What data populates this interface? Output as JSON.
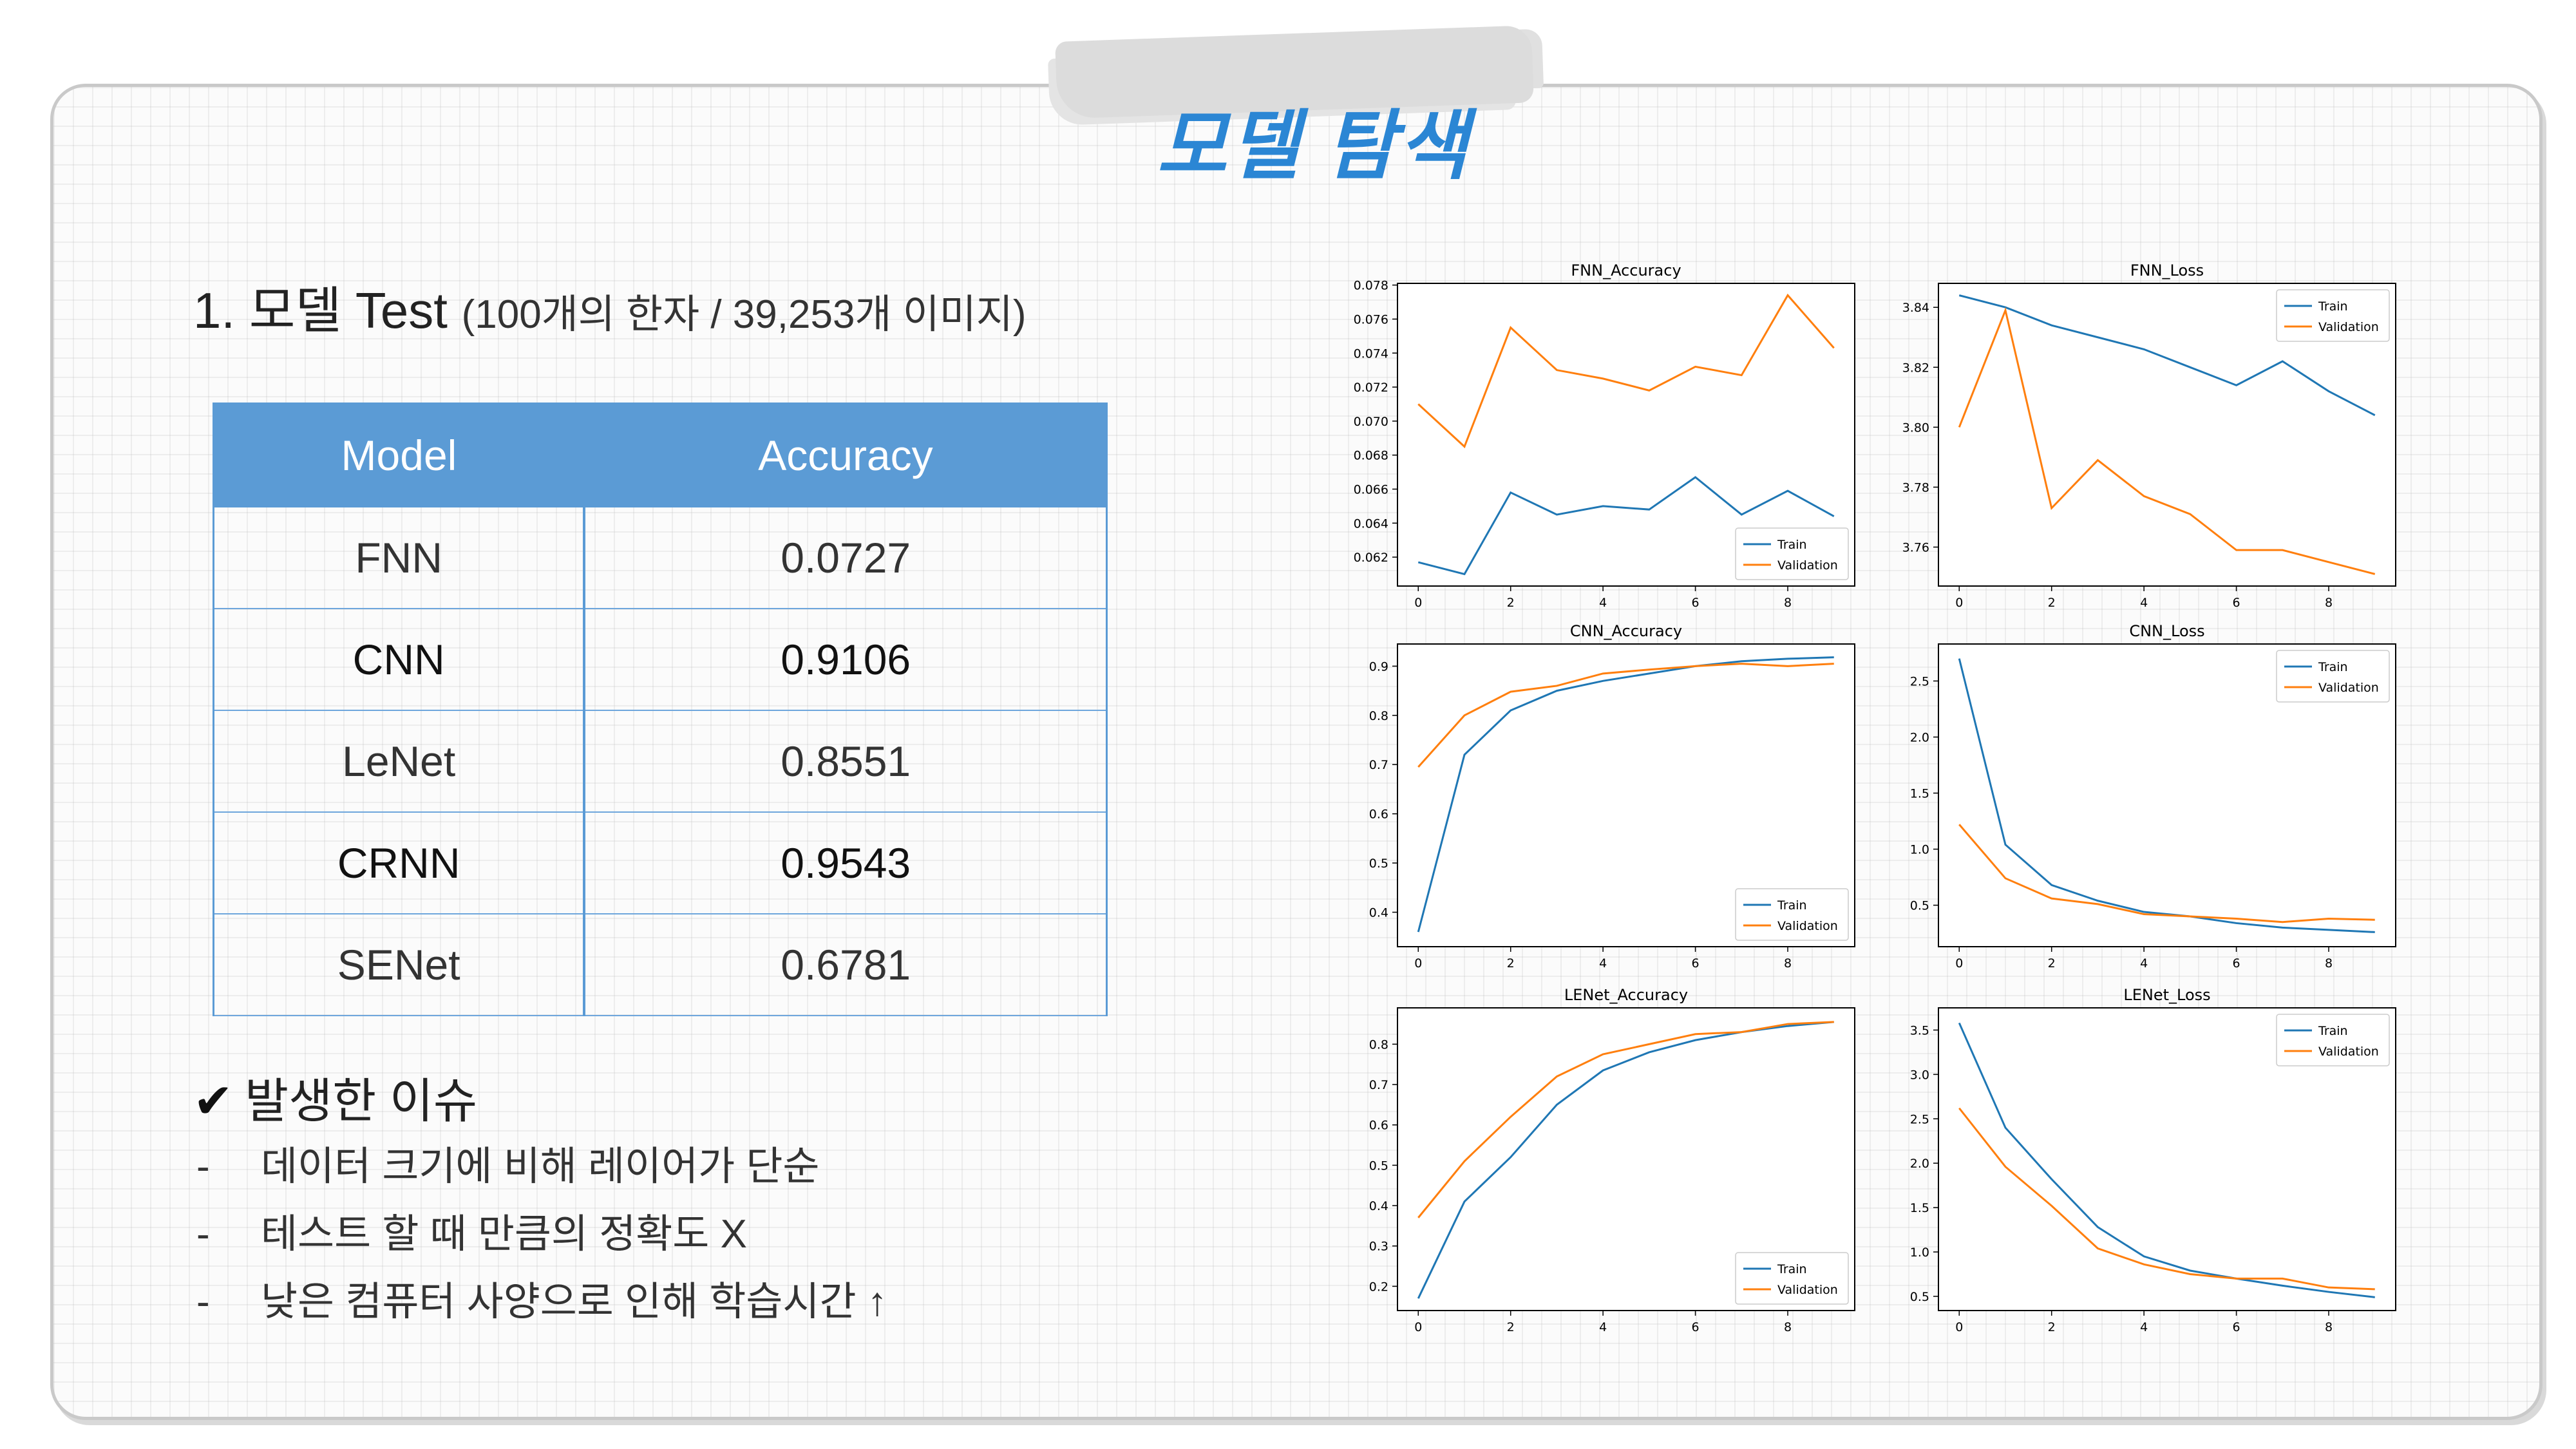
{
  "title": "모델 탐색",
  "section": {
    "heading": "1. 모델 Test",
    "subheading": "(100개의 한자 / 39,253개 이미지)"
  },
  "table": {
    "headers": [
      "Model",
      "Accuracy"
    ],
    "rows": [
      {
        "model": "FNN",
        "accuracy": "0.0727"
      },
      {
        "model": "CNN",
        "accuracy": "0.9106"
      },
      {
        "model": "LeNet",
        "accuracy": "0.8551"
      },
      {
        "model": "CRNN",
        "accuracy": "0.9543"
      },
      {
        "model": "SENet",
        "accuracy": "0.6781"
      }
    ]
  },
  "issues": {
    "check_icon": "✔",
    "title": "발생한 이슈",
    "dash": "-",
    "items": [
      "데이터 크기에 비해 레이어가 단순",
      "테스트 할 때 만큼의 정확도 X",
      "낮은 컴퓨터 사양으로 인해 학습시간 ↑"
    ]
  },
  "colors": {
    "title": "#2b86d4",
    "table_header": "#5b9bd5",
    "train": "#1f77b4",
    "validation": "#ff7f0e"
  },
  "chart_data": [
    {
      "type": "line",
      "title": "FNN_Accuracy",
      "x": [
        0,
        1,
        2,
        3,
        4,
        5,
        6,
        7,
        8,
        9
      ],
      "series": [
        {
          "name": "Train",
          "values": [
            0.0617,
            0.061,
            0.0658,
            0.0645,
            0.065,
            0.0648,
            0.0667,
            0.0645,
            0.0659,
            0.0644
          ]
        },
        {
          "name": "Validation",
          "values": [
            0.071,
            0.0685,
            0.0755,
            0.073,
            0.0725,
            0.0718,
            0.0732,
            0.0727,
            0.0774,
            0.0743
          ]
        }
      ],
      "xlim": [
        -0.45,
        9.45
      ],
      "ylim": [
        0.0603,
        0.0781
      ],
      "xticks": [
        0,
        2,
        4,
        6,
        8
      ],
      "yticks": [
        0.062,
        0.064,
        0.066,
        0.068,
        0.07,
        0.072,
        0.074,
        0.076,
        0.078
      ],
      "ytick_labels": [
        "0.062",
        "0.064",
        "0.066",
        "0.068",
        "0.070",
        "0.072",
        "0.074",
        "0.076",
        "0.078"
      ],
      "legend": "lower-right"
    },
    {
      "type": "line",
      "title": "FNN_Loss",
      "x": [
        0,
        1,
        2,
        3,
        4,
        5,
        6,
        7,
        8,
        9
      ],
      "series": [
        {
          "name": "Train",
          "values": [
            3.844,
            3.84,
            3.834,
            3.83,
            3.826,
            3.82,
            3.814,
            3.822,
            3.812,
            3.804
          ]
        },
        {
          "name": "Validation",
          "values": [
            3.8,
            3.839,
            3.773,
            3.789,
            3.777,
            3.771,
            3.759,
            3.759,
            3.755,
            3.751
          ]
        }
      ],
      "xlim": [
        -0.45,
        9.45
      ],
      "ylim": [
        3.747,
        3.848
      ],
      "xticks": [
        0,
        2,
        4,
        6,
        8
      ],
      "yticks": [
        3.76,
        3.78,
        3.8,
        3.82,
        3.84
      ],
      "ytick_labels": [
        "3.76",
        "3.78",
        "3.80",
        "3.82",
        "3.84"
      ],
      "legend": "upper-right"
    },
    {
      "type": "line",
      "title": "CNN_Accuracy",
      "x": [
        0,
        1,
        2,
        3,
        4,
        5,
        6,
        7,
        8,
        9
      ],
      "series": [
        {
          "name": "Train",
          "values": [
            0.36,
            0.72,
            0.81,
            0.85,
            0.87,
            0.885,
            0.9,
            0.91,
            0.915,
            0.918
          ]
        },
        {
          "name": "Validation",
          "values": [
            0.695,
            0.8,
            0.848,
            0.86,
            0.885,
            0.893,
            0.9,
            0.905,
            0.9,
            0.905
          ]
        }
      ],
      "xlim": [
        -0.45,
        9.45
      ],
      "ylim": [
        0.33,
        0.945
      ],
      "xticks": [
        0,
        2,
        4,
        6,
        8
      ],
      "yticks": [
        0.4,
        0.5,
        0.6,
        0.7,
        0.8,
        0.9
      ],
      "ytick_labels": [
        "0.4",
        "0.5",
        "0.6",
        "0.7",
        "0.8",
        "0.9"
      ],
      "legend": "lower-right"
    },
    {
      "type": "line",
      "title": "CNN_Loss",
      "x": [
        0,
        1,
        2,
        3,
        4,
        5,
        6,
        7,
        8,
        9
      ],
      "series": [
        {
          "name": "Train",
          "values": [
            2.7,
            1.04,
            0.68,
            0.54,
            0.44,
            0.4,
            0.34,
            0.3,
            0.28,
            0.26
          ]
        },
        {
          "name": "Validation",
          "values": [
            1.22,
            0.74,
            0.56,
            0.51,
            0.42,
            0.4,
            0.38,
            0.35,
            0.38,
            0.37
          ]
        }
      ],
      "xlim": [
        -0.45,
        9.45
      ],
      "ylim": [
        0.13,
        2.83
      ],
      "xticks": [
        0,
        2,
        4,
        6,
        8
      ],
      "yticks": [
        0.5,
        1.0,
        1.5,
        2.0,
        2.5
      ],
      "ytick_labels": [
        "0.5",
        "1.0",
        "1.5",
        "2.0",
        "2.5"
      ],
      "legend": "upper-right"
    },
    {
      "type": "line",
      "title": "LENet_Accuracy",
      "x": [
        0,
        1,
        2,
        3,
        4,
        5,
        6,
        7,
        8,
        9
      ],
      "series": [
        {
          "name": "Train",
          "values": [
            0.17,
            0.41,
            0.52,
            0.65,
            0.735,
            0.78,
            0.81,
            0.83,
            0.845,
            0.855
          ]
        },
        {
          "name": "Validation",
          "values": [
            0.37,
            0.51,
            0.62,
            0.72,
            0.775,
            0.8,
            0.825,
            0.83,
            0.85,
            0.855
          ]
        }
      ],
      "xlim": [
        -0.45,
        9.45
      ],
      "ylim": [
        0.14,
        0.89
      ],
      "xticks": [
        0,
        2,
        4,
        6,
        8
      ],
      "yticks": [
        0.2,
        0.3,
        0.4,
        0.5,
        0.6,
        0.7,
        0.8
      ],
      "ytick_labels": [
        "0.2",
        "0.3",
        "0.4",
        "0.5",
        "0.6",
        "0.7",
        "0.8"
      ],
      "legend": "lower-right"
    },
    {
      "type": "line",
      "title": "LENet_Loss",
      "x": [
        0,
        1,
        2,
        3,
        4,
        5,
        6,
        7,
        8,
        9
      ],
      "series": [
        {
          "name": "Train",
          "values": [
            3.58,
            2.4,
            1.82,
            1.28,
            0.95,
            0.79,
            0.7,
            0.62,
            0.55,
            0.49
          ]
        },
        {
          "name": "Validation",
          "values": [
            2.62,
            1.96,
            1.52,
            1.04,
            0.86,
            0.75,
            0.7,
            0.7,
            0.6,
            0.58
          ]
        }
      ],
      "xlim": [
        -0.45,
        9.45
      ],
      "ylim": [
        0.34,
        3.75
      ],
      "xticks": [
        0,
        2,
        4,
        6,
        8
      ],
      "yticks": [
        0.5,
        1.0,
        1.5,
        2.0,
        2.5,
        3.0,
        3.5
      ],
      "ytick_labels": [
        "0.5",
        "1.0",
        "1.5",
        "2.0",
        "2.5",
        "3.0",
        "3.5"
      ],
      "legend": "upper-right"
    }
  ]
}
